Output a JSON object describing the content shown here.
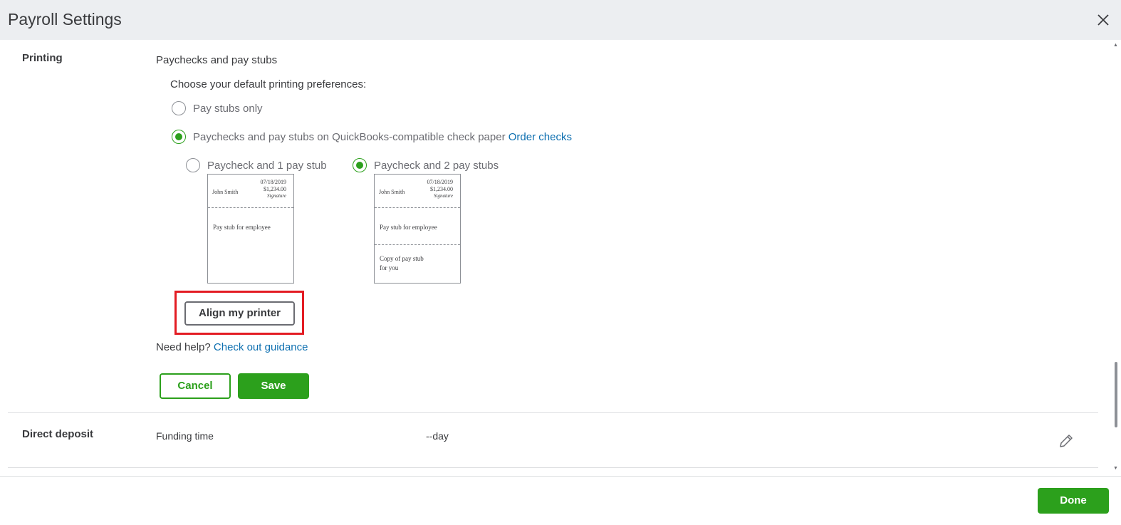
{
  "header": {
    "title": "Payroll Settings",
    "close_icon": "close-icon"
  },
  "printing": {
    "section_label": "Printing",
    "subtitle": "Paychecks and pay stubs",
    "prompt": "Choose your default printing preferences:",
    "options": [
      {
        "label": "Pay stubs only",
        "selected": false
      },
      {
        "label": "Paychecks and pay stubs on QuickBooks-compatible check paper",
        "selected": true,
        "link": "Order checks"
      }
    ],
    "layouts": [
      {
        "label": "Paycheck and 1 pay stub",
        "selected": false,
        "preview": {
          "date": "07/18/2019",
          "amount": "$1,234.00",
          "name": "John Smith",
          "signature": "Signature",
          "stub_text": "Pay stub for employee"
        }
      },
      {
        "label": "Paycheck and 2 pay stubs",
        "selected": true,
        "preview": {
          "date": "07/18/2019",
          "amount": "$1,234.00",
          "name": "John Smith",
          "signature": "Signature",
          "stub_text": "Pay stub for employee",
          "copy_line1": "Copy of pay stub",
          "copy_line2": "for you"
        }
      }
    ],
    "align_button": "Align my printer",
    "help_text": "Need help?",
    "help_link": "Check out guidance",
    "cancel_button": "Cancel",
    "save_button": "Save"
  },
  "direct_deposit": {
    "section_label": "Direct deposit",
    "field_label": "Funding time",
    "field_value": "--day",
    "edit_icon": "pencil-icon"
  },
  "footer": {
    "done_button": "Done"
  },
  "colors": {
    "accent_green": "#2ca01c",
    "link_blue": "#0d6fb0",
    "highlight_red": "#e31c23",
    "header_bg": "#eceef1"
  }
}
